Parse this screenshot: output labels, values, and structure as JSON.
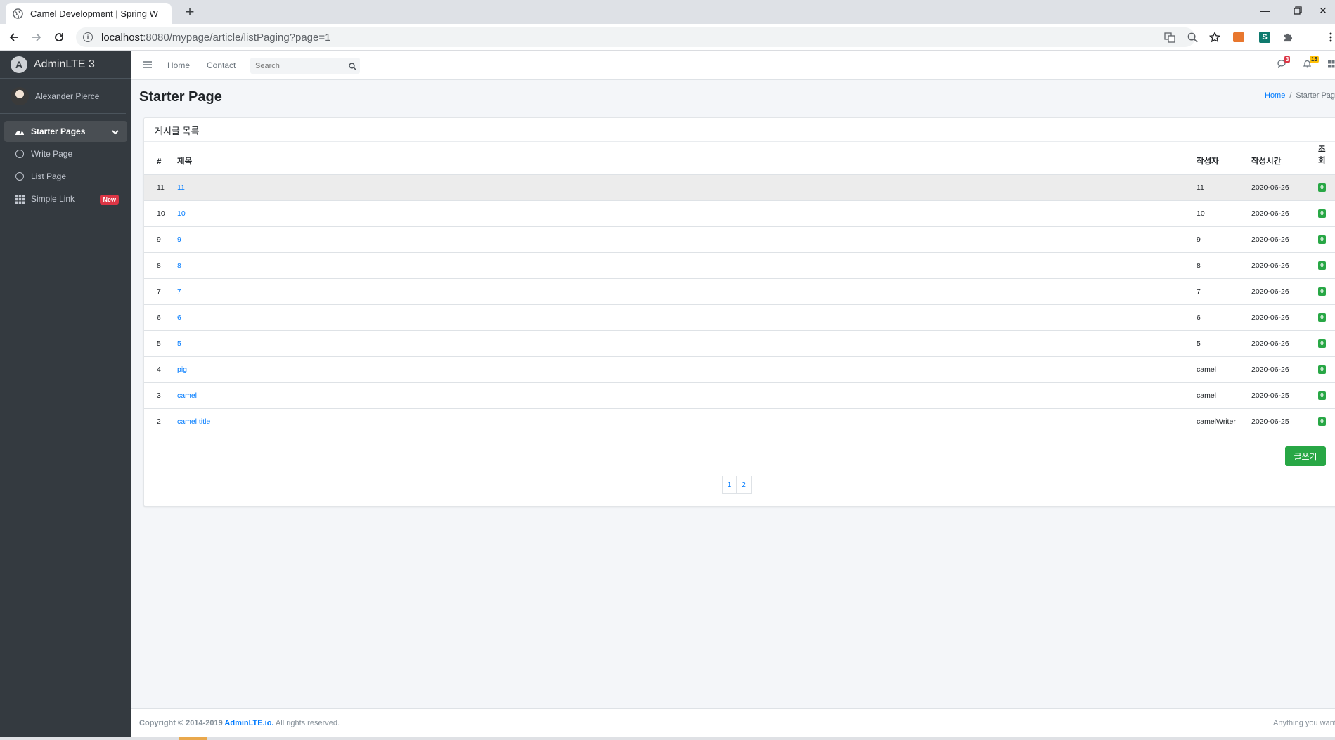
{
  "browser": {
    "tab_title": "Camel Development | Spring W",
    "url_host": "localhost",
    "url_path": ":8080/mypage/article/listPaging?page=1"
  },
  "sidebar": {
    "brand": "AdminLTE 3",
    "user": "Alexander Pierce",
    "items": [
      {
        "label": "Starter Pages"
      },
      {
        "label": "Write Page"
      },
      {
        "label": "List Page"
      },
      {
        "label": "Simple Link",
        "badge": "New"
      }
    ]
  },
  "topnav": {
    "links": [
      "Home",
      "Contact"
    ],
    "search_placeholder": "Search",
    "messages_count": "3",
    "notifications_count": "15"
  },
  "page": {
    "title": "Starter Page",
    "breadcrumb": [
      "Home",
      "Starter Page"
    ]
  },
  "card": {
    "header": "게시글 목록",
    "columns": [
      "#",
      "제목",
      "작성자",
      "작성시간",
      "조회"
    ],
    "rows": [
      {
        "num": "11",
        "title": "11",
        "writer": "11",
        "date": "2020-06-26",
        "views": "0"
      },
      {
        "num": "10",
        "title": "10",
        "writer": "10",
        "date": "2020-06-26",
        "views": "0"
      },
      {
        "num": "9",
        "title": "9",
        "writer": "9",
        "date": "2020-06-26",
        "views": "0"
      },
      {
        "num": "8",
        "title": "8",
        "writer": "8",
        "date": "2020-06-26",
        "views": "0"
      },
      {
        "num": "7",
        "title": "7",
        "writer": "7",
        "date": "2020-06-26",
        "views": "0"
      },
      {
        "num": "6",
        "title": "6",
        "writer": "6",
        "date": "2020-06-26",
        "views": "0"
      },
      {
        "num": "5",
        "title": "5",
        "writer": "5",
        "date": "2020-06-26",
        "views": "0"
      },
      {
        "num": "4",
        "title": "pig",
        "writer": "camel",
        "date": "2020-06-26",
        "views": "0"
      },
      {
        "num": "3",
        "title": "camel",
        "writer": "camel",
        "date": "2020-06-25",
        "views": "0"
      },
      {
        "num": "2",
        "title": "camel title",
        "writer": "camelWriter",
        "date": "2020-06-25",
        "views": "0"
      }
    ],
    "write_button": "글쓰기",
    "pages": [
      "1",
      "2"
    ]
  },
  "footer": {
    "copyright": "Copyright © 2014-2019 ",
    "link": "AdminLTE.io.",
    "rest": " All rights reserved.",
    "right": "Anything you want"
  },
  "colors": {
    "sidebar": "#343a40",
    "link": "#007bff",
    "success": "#28a745",
    "danger": "#dc3545",
    "warning": "#ffc107"
  }
}
